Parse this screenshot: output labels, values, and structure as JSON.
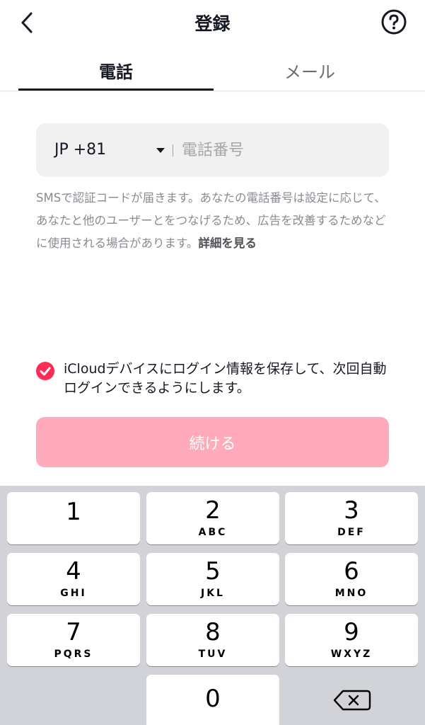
{
  "header": {
    "title": "登録",
    "back_icon": "chevron-left-icon",
    "help_icon": "question-circle-icon"
  },
  "tabs": [
    {
      "label": "電話",
      "active": true
    },
    {
      "label": "メール",
      "active": false
    }
  ],
  "phone": {
    "country_code": "JP +81",
    "placeholder": "電話番号",
    "value": ""
  },
  "notice": {
    "text": "SMSで認証コードが届きます。あなたの電話番号は設定に応じて、あなたと他のユーザーとをつなげるため、広告を改善するためなどに使用される場合があります。",
    "link": "詳細を見る"
  },
  "save_login": {
    "checked": true,
    "text": "iCloudデバイスにログイン情報を保存して、次回自動ログインできるようにします。"
  },
  "continue_label": "続ける",
  "colors": {
    "accent": "#fe2c55",
    "button_disabled": "#ffabbb",
    "keypad_bg": "#d1d3d9"
  },
  "keypad": {
    "keys": [
      {
        "digit": "1",
        "letters": ""
      },
      {
        "digit": "2",
        "letters": "ABC"
      },
      {
        "digit": "3",
        "letters": "DEF"
      },
      {
        "digit": "4",
        "letters": "GHI"
      },
      {
        "digit": "5",
        "letters": "JKL"
      },
      {
        "digit": "6",
        "letters": "MNO"
      },
      {
        "digit": "7",
        "letters": "PQRS"
      },
      {
        "digit": "8",
        "letters": "TUV"
      },
      {
        "digit": "9",
        "letters": "WXYZ"
      },
      {
        "digit": "0",
        "letters": ""
      }
    ],
    "delete_icon": "backspace-icon"
  }
}
